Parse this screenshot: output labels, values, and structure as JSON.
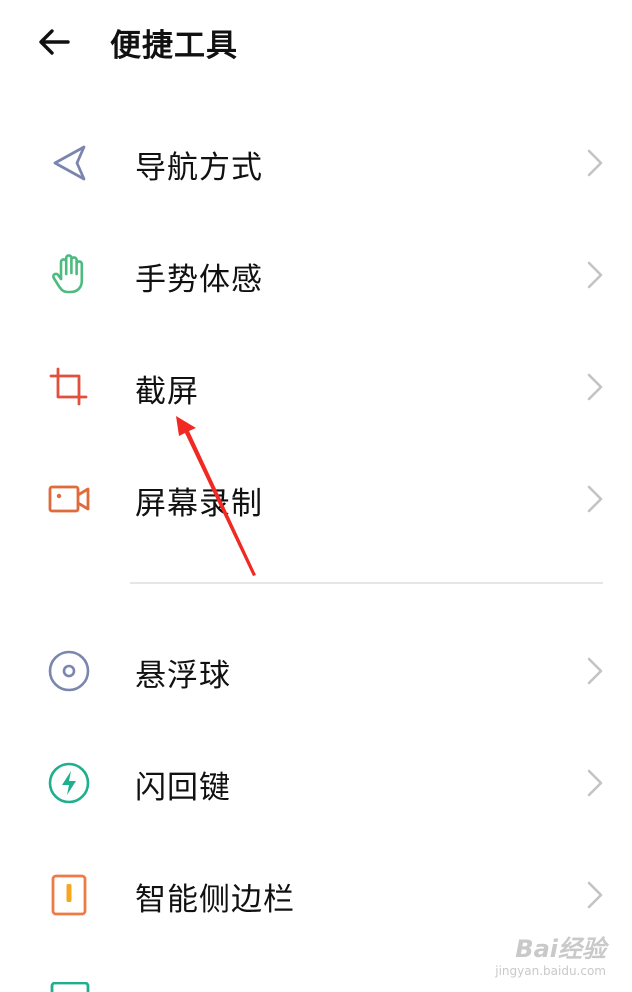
{
  "header": {
    "title": "便捷工具",
    "back_icon": "back-arrow-icon"
  },
  "group1": [
    {
      "id": "navigation",
      "label": "导航方式",
      "icon": "navigation-arrow-icon",
      "color": "#7a86ad"
    },
    {
      "id": "gestures",
      "label": "手势体感",
      "icon": "hand-icon",
      "color": "#4dbb7f"
    },
    {
      "id": "screenshot",
      "label": "截屏",
      "icon": "crop-icon",
      "color": "#e0503d"
    },
    {
      "id": "screen-record",
      "label": "屏幕录制",
      "icon": "video-camera-icon",
      "color": "#e06a3a"
    }
  ],
  "group2": [
    {
      "id": "floating-ball",
      "label": "悬浮球",
      "icon": "floating-ball-icon",
      "color": "#7a86ad"
    },
    {
      "id": "flash-key",
      "label": "闪回键",
      "icon": "flash-icon",
      "color": "#1fae8e"
    },
    {
      "id": "smart-sidebar",
      "label": "智能侧边栏",
      "icon": "sidebar-icon",
      "color": "#f07a45"
    }
  ],
  "watermark": {
    "logo": "Bai经验",
    "url": "jingyan.baidu.com"
  },
  "colors": {
    "annotation_arrow": "#f02a22",
    "divider": "#e6e6e6",
    "chevron": "#c4c4c4"
  }
}
